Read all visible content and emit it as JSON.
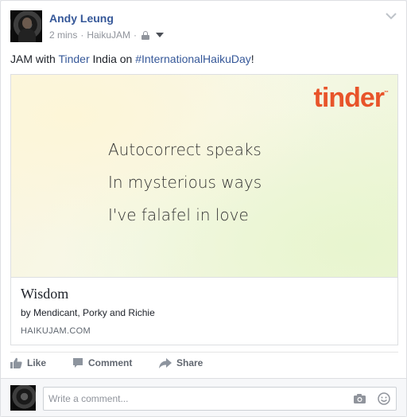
{
  "post": {
    "author": "Andy Leung",
    "time": "2 mins",
    "via": "HaikuJAM",
    "separator": "·",
    "status_parts": {
      "before": "JAM with ",
      "tag": "Tinder",
      "middle": " India on ",
      "hashtag": "#InternationalHaikuDay",
      "after": "!"
    }
  },
  "card": {
    "logo": "tinder",
    "haiku": [
      "Autocorrect speaks",
      "In mysterious ways",
      "I've falafel in love"
    ],
    "title": "Wisdom",
    "description": "by Mendicant, Porky and Richie",
    "domain": "HAIKUJAM.COM"
  },
  "actions": {
    "like": "Like",
    "comment": "Comment",
    "share": "Share"
  },
  "comment_box": {
    "placeholder": "Write a comment..."
  },
  "colors": {
    "link": "#365899",
    "tinder": "#e8542a",
    "muted": "#90949c"
  }
}
